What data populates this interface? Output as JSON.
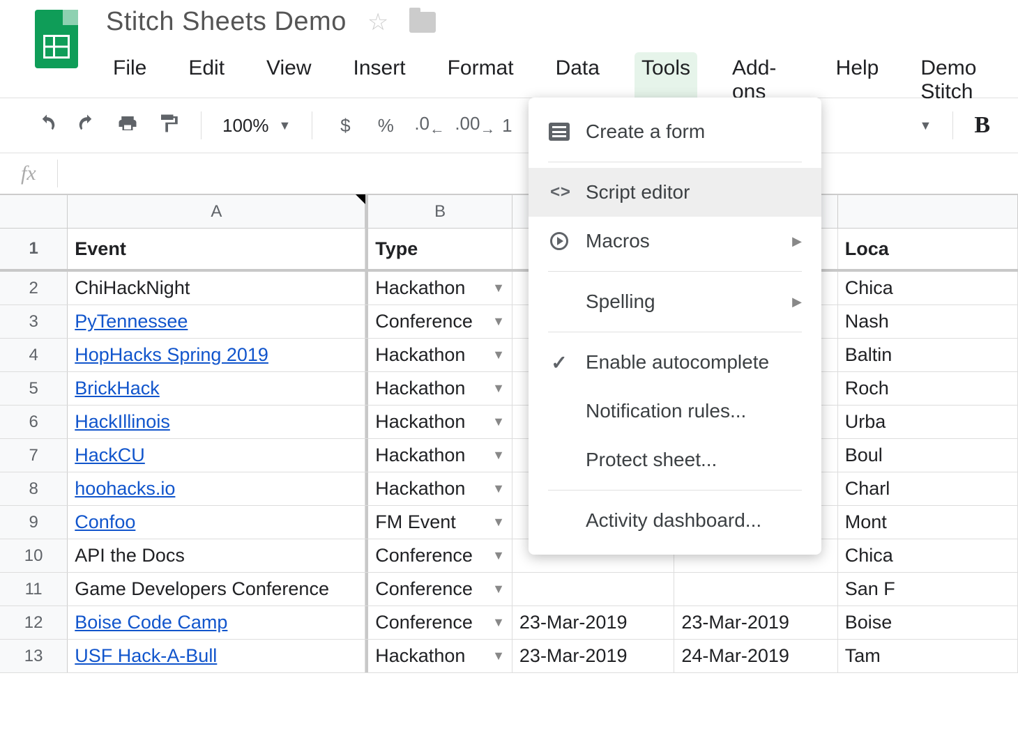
{
  "doc_title": "Stitch Sheets Demo",
  "menubar": {
    "file": "File",
    "edit": "Edit",
    "view": "View",
    "insert": "Insert",
    "format": "Format",
    "data": "Data",
    "tools": "Tools",
    "addons": "Add-ons",
    "help": "Help",
    "demo": "Demo Stitch"
  },
  "toolbar": {
    "zoom": "100%",
    "currency": "$",
    "percent": "%",
    "dec_dec": ".0",
    "inc_dec": ".00",
    "fontsize_partial": "1",
    "bold": "B"
  },
  "formula_label": "fx",
  "columns": {
    "A": "A",
    "B": "B"
  },
  "headers": {
    "event": "Event",
    "type": "Type",
    "location": "Loca"
  },
  "rows": [
    {
      "n": "1"
    },
    {
      "n": "2",
      "event": "ChiHackNight",
      "link": false,
      "type": "Hackathon",
      "c": "",
      "d": "",
      "loc": "Chica"
    },
    {
      "n": "3",
      "event": "PyTennessee",
      "link": true,
      "type": "Conference",
      "c": "",
      "d": "",
      "loc": "Nash"
    },
    {
      "n": "4",
      "event": "HopHacks Spring 2019",
      "link": true,
      "type": "Hackathon",
      "c": "",
      "d": "",
      "loc": "Baltin"
    },
    {
      "n": "5",
      "event": "BrickHack",
      "link": true,
      "type": "Hackathon",
      "c": "",
      "d": "",
      "loc": "Roch"
    },
    {
      "n": "6",
      "event": "HackIllinois",
      "link": true,
      "type": "Hackathon",
      "c": "",
      "d": "",
      "loc": "Urba"
    },
    {
      "n": "7",
      "event": "HackCU",
      "link": true,
      "type": "Hackathon",
      "c": "",
      "d": "",
      "loc": "Boul"
    },
    {
      "n": "8",
      "event": "hoohacks.io",
      "link": true,
      "type": "Hackathon",
      "c": "",
      "d": "",
      "loc": "Charl"
    },
    {
      "n": "9",
      "event": "Confoo",
      "link": true,
      "type": "FM Event",
      "c": "",
      "d": "",
      "loc": "Mont"
    },
    {
      "n": "10",
      "event": "API the Docs",
      "link": false,
      "type": "Conference",
      "c": "",
      "d": "",
      "loc": "Chica"
    },
    {
      "n": "11",
      "event": "Game Developers Conference",
      "link": false,
      "type": "Conference",
      "c": "",
      "d": "",
      "loc": "San F"
    },
    {
      "n": "12",
      "event": "Boise Code Camp",
      "link": true,
      "type": "Conference",
      "c": "23-Mar-2019",
      "d": "23-Mar-2019",
      "loc": "Boise"
    },
    {
      "n": "13",
      "event": "USF Hack-A-Bull",
      "link": true,
      "type": "Hackathon",
      "c": "23-Mar-2019",
      "d": "24-Mar-2019",
      "loc": "Tam"
    }
  ],
  "tools_menu": {
    "create_form": "Create a form",
    "script_editor": "Script editor",
    "macros": "Macros",
    "spelling": "Spelling",
    "autocomplete": "Enable autocomplete",
    "notifications": "Notification rules...",
    "protect": "Protect sheet...",
    "activity": "Activity dashboard..."
  }
}
